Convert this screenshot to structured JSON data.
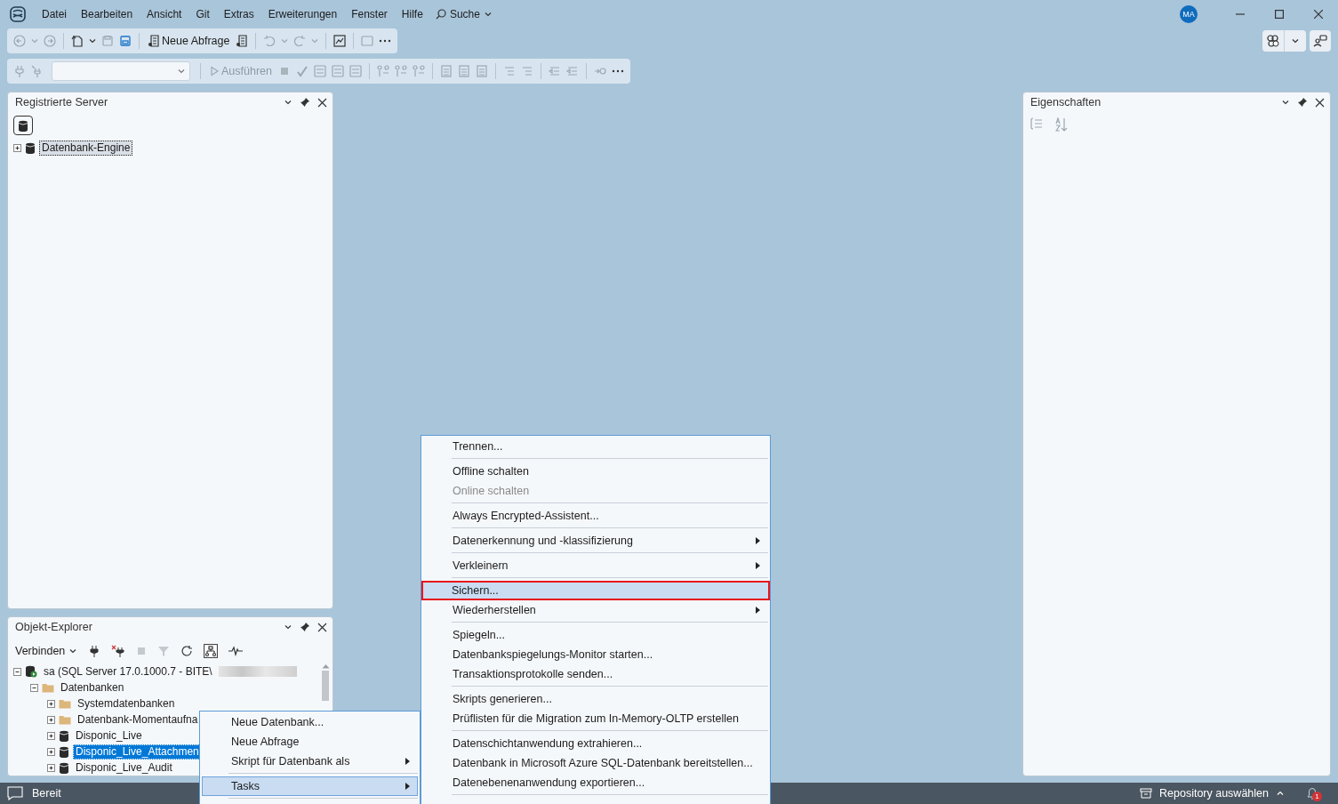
{
  "title_bar": {
    "menu": [
      "Datei",
      "Bearbeiten",
      "Ansicht",
      "Git",
      "Extras",
      "Erweiterungen",
      "Fenster",
      "Hilfe"
    ],
    "search": "Suche",
    "avatar": "MA"
  },
  "toolbar": {
    "new_query": {
      "label": "Neue Abfrage",
      "disabled": false
    },
    "execute": {
      "label": "Ausführen",
      "disabled": true
    }
  },
  "registered_servers": {
    "title": "Registrierte Server",
    "tree": [
      {
        "label": "Datenbank-Engine",
        "kind": "engine",
        "expanded": false,
        "selected": true
      }
    ]
  },
  "object_explorer": {
    "title": "Objekt-Explorer",
    "connect": "Verbinden",
    "tree": [
      {
        "label": "sa (SQL Server 17.0.1000.7 - BITE\\",
        "kind": "server",
        "expanded": true,
        "selected": false,
        "children": [
          {
            "label": "Datenbanken",
            "kind": "folder",
            "expanded": true,
            "selected": false,
            "children": [
              {
                "label": "Systemdatenbanken",
                "kind": "folder",
                "expanded": false,
                "selected": false
              },
              {
                "label": "Datenbank-Momentaufna",
                "kind": "folder",
                "expanded": false,
                "selected": false
              },
              {
                "label": "Disponic_Live",
                "kind": "database",
                "expanded": false,
                "selected": false
              },
              {
                "label": "Disponic_Live_Attachmen",
                "kind": "database",
                "expanded": false,
                "selected": true
              },
              {
                "label": "Disponic_Live_Audit",
                "kind": "database",
                "expanded": false,
                "selected": false
              }
            ]
          }
        ]
      }
    ]
  },
  "properties": {
    "title": "Eigenschaften"
  },
  "status_bar": {
    "text": "Bereit",
    "repository": "Repository auswählen",
    "notifications": "1"
  },
  "context_menu": {
    "groups": [
      [
        {
          "label": "Neue Datenbank...",
          "submenu": false,
          "disabled": false,
          "selected": false
        },
        {
          "label": "Neue Abfrage",
          "submenu": false,
          "disabled": false,
          "selected": false
        },
        {
          "label": "Skript für Datenbank als",
          "submenu": true,
          "disabled": false,
          "selected": false
        }
      ],
      [
        {
          "label": "Tasks",
          "submenu": true,
          "disabled": false,
          "selected": true
        }
      ]
    ]
  },
  "tasks_menu": {
    "groups": [
      [
        {
          "label": "Trennen...",
          "submenu": false,
          "disabled": false,
          "selected": false,
          "outlined": false
        }
      ],
      [
        {
          "label": "Offline schalten",
          "submenu": false,
          "disabled": false,
          "selected": false,
          "outlined": false
        },
        {
          "label": "Online schalten",
          "submenu": false,
          "disabled": true,
          "selected": false,
          "outlined": false
        }
      ],
      [
        {
          "label": "Always Encrypted-Assistent...",
          "submenu": false,
          "disabled": false,
          "selected": false,
          "outlined": false
        }
      ],
      [
        {
          "label": "Datenerkennung und -klassifizierung",
          "submenu": true,
          "disabled": false,
          "selected": false,
          "outlined": false
        }
      ],
      [
        {
          "label": "Verkleinern",
          "submenu": true,
          "disabled": false,
          "selected": false,
          "outlined": false
        }
      ],
      [
        {
          "label": "Sichern...",
          "submenu": false,
          "disabled": false,
          "selected": true,
          "outlined": true
        },
        {
          "label": "Wiederherstellen",
          "submenu": true,
          "disabled": false,
          "selected": false,
          "outlined": false
        }
      ],
      [
        {
          "label": "Spiegeln...",
          "submenu": false,
          "disabled": false,
          "selected": false,
          "outlined": false
        },
        {
          "label": "Datenbankspiegelungs-Monitor starten...",
          "submenu": false,
          "disabled": false,
          "selected": false,
          "outlined": false
        },
        {
          "label": "Transaktionsprotokolle senden...",
          "submenu": false,
          "disabled": false,
          "selected": false,
          "outlined": false
        }
      ],
      [
        {
          "label": "Skripts generieren...",
          "submenu": false,
          "disabled": false,
          "selected": false,
          "outlined": false
        },
        {
          "label": "Prüflisten für die Migration zum In-Memory-OLTP erstellen",
          "submenu": false,
          "disabled": false,
          "selected": false,
          "outlined": false
        }
      ],
      [
        {
          "label": "Datenschichtanwendung extrahieren...",
          "submenu": false,
          "disabled": false,
          "selected": false,
          "outlined": false
        },
        {
          "label": "Datenbank in Microsoft Azure SQL-Datenbank bereitstellen...",
          "submenu": false,
          "disabled": false,
          "selected": false,
          "outlined": false
        },
        {
          "label": "Datenebenenanwendung exportieren...",
          "submenu": false,
          "disabled": false,
          "selected": false,
          "outlined": false
        }
      ]
    ]
  }
}
